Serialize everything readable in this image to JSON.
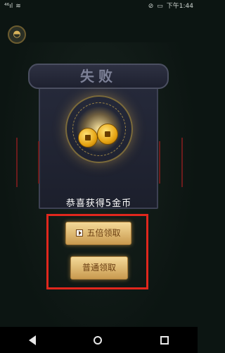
{
  "status_bar": {
    "signal": "⁴⁶ıl",
    "wifi": "≋",
    "alarm_icon": "alarm-off-icon",
    "time": "下午1:44"
  },
  "back_button": {
    "icon": "helmet-icon"
  },
  "banner": {
    "title": "失败"
  },
  "reward": {
    "caption": "恭喜获得5金币"
  },
  "buttons": {
    "five_times": "五倍领取",
    "normal": "普通领取"
  },
  "colors": {
    "highlight": "#e0271d",
    "button_gold": "#f4d998",
    "background": "#0c1512"
  }
}
